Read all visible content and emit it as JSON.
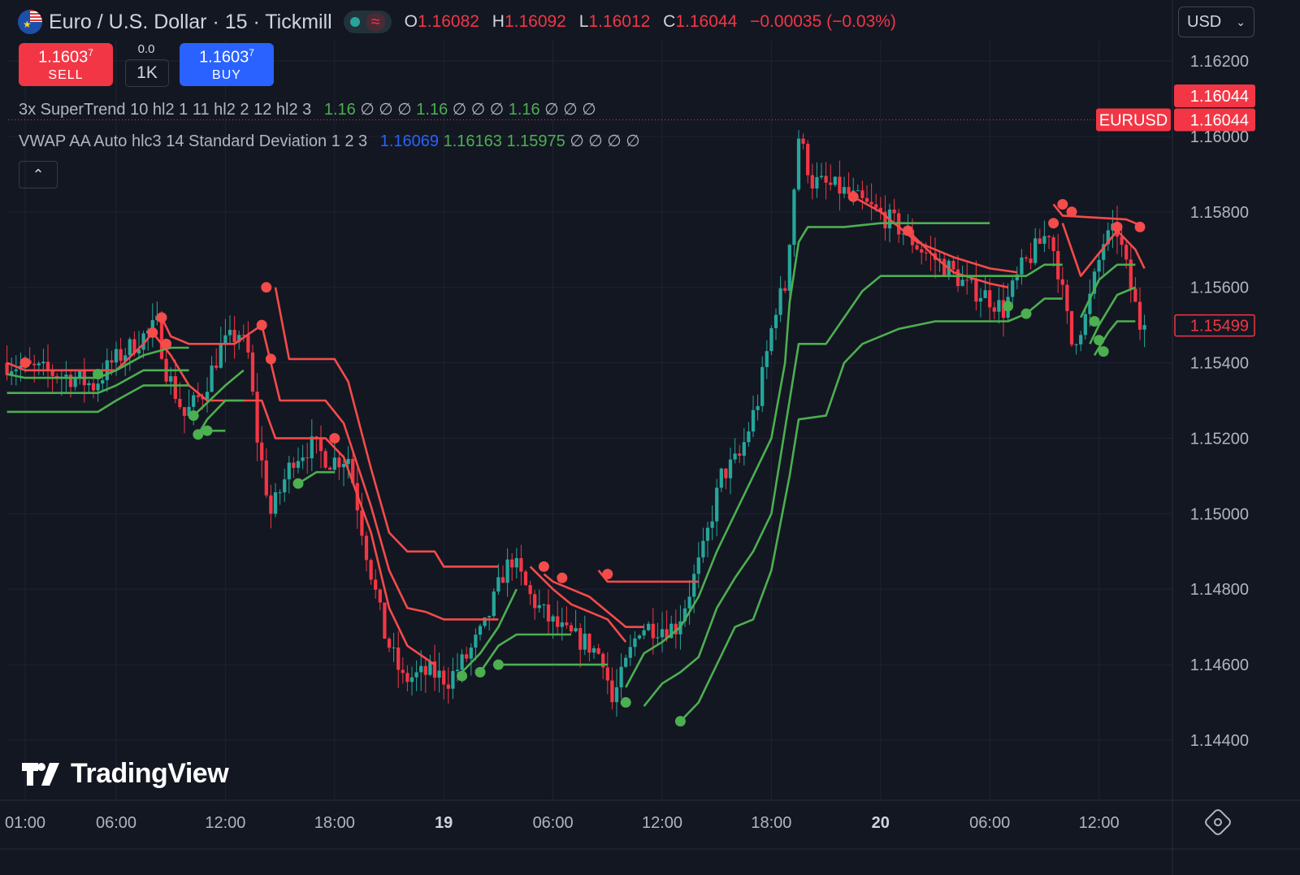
{
  "header": {
    "symbol_title": "Euro / U.S. Dollar · 15 · Tickmill",
    "o_label": "O",
    "o_value": "1.16082",
    "h_label": "H",
    "h_value": "1.16092",
    "l_label": "L",
    "l_value": "1.16012",
    "c_label": "C",
    "c_value": "1.16044",
    "change": "−0.00035 (−0.03%)",
    "currency": "USD"
  },
  "trade": {
    "sell_price": "1.1603",
    "sell_sup": "7",
    "sell_label": "SELL",
    "spread": "0.0",
    "quantity": "1K",
    "buy_price": "1.1603",
    "buy_sup": "7",
    "buy_label": "BUY"
  },
  "indicators": {
    "supertrend": {
      "name": "3x SuperTrend 10 hl2 1 11 hl2 2 12 hl2 3",
      "v1": "1.16",
      "v2": "1.16",
      "v3": "1.16",
      "na": "∅ ∅ ∅"
    },
    "vwap": {
      "name": "VWAP AA Auto hlc3 14 Standard Deviation 1 2 3",
      "v1": "1.16069",
      "v2": "1.16163",
      "v3": "1.15975",
      "na": "∅ ∅ ∅ ∅"
    }
  },
  "branding": "TradingView",
  "colors": {
    "up": "#26a69a",
    "down": "#f23645",
    "bg": "#131722",
    "st_red": "#f44b4b",
    "st_green": "#4caf50",
    "blue": "#2962ff"
  },
  "chart_data": {
    "type": "candlestick",
    "symbol_label": "EURUSD",
    "last_price": 1.16044,
    "marked_price": 1.15499,
    "y_ticks": [
      1.162,
      1.16,
      1.158,
      1.156,
      1.154,
      1.152,
      1.15,
      1.148,
      1.146,
      1.144
    ],
    "y_tick_labels": [
      "1.16200",
      "1.16000",
      "1.15800",
      "1.15600",
      "1.15400",
      "1.15200",
      "1.15000",
      "1.14800",
      "1.14600",
      "1.14400"
    ],
    "ylim": [
      1.1432,
      1.1633
    ],
    "x_ticks": [
      "01:00",
      "06:00",
      "12:00",
      "18:00",
      "19",
      "06:00",
      "12:00",
      "18:00",
      "20",
      "06:00",
      "12:00"
    ],
    "x_tick_bold": [
      false,
      false,
      false,
      false,
      true,
      false,
      false,
      false,
      true,
      false,
      false
    ],
    "x_tick_time": [
      "18 01:00",
      "18 06:00",
      "18 12:00",
      "18 18:00",
      "19 00:00",
      "19 06:00",
      "19 12:00",
      "19 18:00",
      "20 00:00",
      "20 06:00",
      "20 12:00"
    ],
    "close_path": [
      [
        "18 00:00",
        1.154
      ],
      [
        "18 01:00",
        1.1539
      ],
      [
        "18 04:00",
        1.1536
      ],
      [
        "18 05:00",
        1.1534
      ],
      [
        "18 06:00",
        1.154
      ],
      [
        "18 07:30",
        1.1546
      ],
      [
        "18 08:30",
        1.155
      ],
      [
        "18 09:00",
        1.1538
      ],
      [
        "18 10:00",
        1.1526
      ],
      [
        "18 11:00",
        1.1532
      ],
      [
        "18 12:00",
        1.1544
      ],
      [
        "18 13:00",
        1.1548
      ],
      [
        "18 13:30",
        1.1542
      ],
      [
        "18 14:00",
        1.152
      ],
      [
        "18 14:45",
        1.15
      ],
      [
        "18 16:00",
        1.1515
      ],
      [
        "18 17:00",
        1.1518
      ],
      [
        "18 18:00",
        1.1514
      ],
      [
        "18 19:00",
        1.1515
      ],
      [
        "18 20:00",
        1.149
      ],
      [
        "18 21:00",
        1.1468
      ],
      [
        "18 22:00",
        1.1456
      ],
      [
        "18 23:30",
        1.1458
      ],
      [
        "19 00:30",
        1.1456
      ],
      [
        "19 01:30",
        1.1462
      ],
      [
        "19 02:30",
        1.147
      ],
      [
        "19 03:30",
        1.1484
      ],
      [
        "19 04:00",
        1.1488
      ],
      [
        "19 05:00",
        1.1478
      ],
      [
        "19 06:00",
        1.1472
      ],
      [
        "19 07:00",
        1.1468
      ],
      [
        "19 08:00",
        1.1466
      ],
      [
        "19 09:00",
        1.1462
      ],
      [
        "19 09:30",
        1.145
      ],
      [
        "19 10:15",
        1.146
      ],
      [
        "19 11:00",
        1.147
      ],
      [
        "19 12:00",
        1.147
      ],
      [
        "19 13:00",
        1.147
      ],
      [
        "19 13:30",
        1.1476
      ],
      [
        "19 14:30",
        1.149
      ],
      [
        "19 15:30",
        1.151
      ],
      [
        "19 16:30",
        1.1515
      ],
      [
        "19 17:30",
        1.153
      ],
      [
        "19 18:30",
        1.1555
      ],
      [
        "19 19:00",
        1.156
      ],
      [
        "19 19:45",
        1.16
      ],
      [
        "19 20:30",
        1.1588
      ],
      [
        "19 22:00",
        1.1586
      ],
      [
        "20 00:00",
        1.158
      ],
      [
        "20 01:00",
        1.1577
      ],
      [
        "20 02:30",
        1.157
      ],
      [
        "20 04:00",
        1.1565
      ],
      [
        "20 05:00",
        1.156
      ],
      [
        "20 06:00",
        1.1558
      ],
      [
        "20 07:00",
        1.1554
      ],
      [
        "20 08:00",
        1.1565
      ],
      [
        "20 09:30",
        1.1575
      ],
      [
        "20 10:00",
        1.1565
      ],
      [
        "20 10:45",
        1.1545
      ],
      [
        "20 11:30",
        1.1552
      ],
      [
        "20 12:30",
        1.1572
      ],
      [
        "20 13:15",
        1.1575
      ],
      [
        "20 14:00",
        1.156
      ],
      [
        "20 14:30",
        1.155
      ]
    ],
    "supertrend": {
      "red_1": [
        [
          "18 00:00",
          1.154
        ],
        [
          "18 01:00",
          1.1538
        ],
        [
          "18 06:00",
          1.1538
        ],
        [
          "18 07:30",
          1.1545
        ],
        [
          "18 08:00",
          1.1548
        ],
        [
          "18 09:00",
          1.1542
        ],
        [
          "18 10:00",
          1.1534
        ],
        [
          "18 11:00",
          1.153
        ],
        [
          "18 14:00",
          1.153
        ],
        [
          "18 14:45",
          1.152
        ],
        [
          "18 17:30",
          1.152
        ],
        [
          "18 18:30",
          1.1515
        ],
        [
          "18 20:00",
          1.1495
        ],
        [
          "18 21:00",
          1.1475
        ],
        [
          "18 22:00",
          1.1465
        ],
        [
          "18 23:30",
          1.146
        ]
      ],
      "red_2": [
        [
          "18 08:30",
          1.1552
        ],
        [
          "18 09:00",
          1.1547
        ],
        [
          "18 10:00",
          1.1545
        ],
        [
          "18 12:30",
          1.1545
        ],
        [
          "18 14:00",
          1.155
        ],
        [
          "18 14:30",
          1.154
        ],
        [
          "18 15:00",
          1.153
        ],
        [
          "18 17:30",
          1.153
        ],
        [
          "18 18:30",
          1.1524
        ],
        [
          "18 20:00",
          1.1502
        ],
        [
          "18 21:00",
          1.1485
        ],
        [
          "18 22:00",
          1.1475
        ],
        [
          "18 23:00",
          1.1474
        ],
        [
          "19 00:00",
          1.1472
        ],
        [
          "19 03:00",
          1.1472
        ]
      ],
      "red_3": [
        [
          "18 14:45",
          1.156
        ],
        [
          "18 15:30",
          1.1541
        ],
        [
          "18 18:00",
          1.1541
        ],
        [
          "18 18:45",
          1.1535
        ],
        [
          "18 20:00",
          1.1512
        ],
        [
          "18 21:00",
          1.1495
        ],
        [
          "18 22:00",
          1.149
        ],
        [
          "18 23:30",
          1.149
        ],
        [
          "19 00:00",
          1.1486
        ],
        [
          "19 03:00",
          1.1486
        ]
      ],
      "red_4": [
        [
          "19 04:45",
          1.1486
        ],
        [
          "19 06:00",
          1.148
        ],
        [
          "19 07:00",
          1.1476
        ],
        [
          "19 08:00",
          1.1474
        ],
        [
          "19 09:00",
          1.1472
        ],
        [
          "19 10:00",
          1.1466
        ]
      ],
      "red_5": [
        [
          "19 05:30",
          1.1484
        ],
        [
          "19 06:00",
          1.1482
        ],
        [
          "19 07:00",
          1.148
        ],
        [
          "19 08:00",
          1.1478
        ],
        [
          "19 09:00",
          1.1474
        ],
        [
          "19 10:00",
          1.147
        ],
        [
          "19 11:00",
          1.147
        ]
      ],
      "red_6": [
        [
          "19 08:30",
          1.1485
        ],
        [
          "19 09:00",
          1.1482
        ],
        [
          "19 14:00",
          1.1482
        ]
      ],
      "red_7": [
        [
          "19 22:30",
          1.1584
        ],
        [
          "20 00:00",
          1.158
        ],
        [
          "20 02:00",
          1.1572
        ],
        [
          "20 04:00",
          1.1568
        ],
        [
          "20 06:00",
          1.1565
        ],
        [
          "20 07:30",
          1.1564
        ]
      ],
      "red_8": [
        [
          "20 01:30",
          1.1575
        ],
        [
          "20 03:00",
          1.1568
        ],
        [
          "20 04:00",
          1.1564
        ],
        [
          "20 06:00",
          1.1561
        ],
        [
          "20 07:00",
          1.156
        ]
      ],
      "red_9": [
        [
          "20 09:30",
          1.1582
        ],
        [
          "20 10:00",
          1.1579
        ],
        [
          "20 13:30",
          1.1578
        ],
        [
          "20 14:30",
          1.1576
        ]
      ],
      "red_10": [
        [
          "20 10:00",
          1.1577
        ],
        [
          "20 11:00",
          1.1563
        ],
        [
          "20 13:00",
          1.1575
        ],
        [
          "20 14:00",
          1.157
        ],
        [
          "20 14:30",
          1.1565
        ]
      ],
      "green_1": [
        [
          "18 00:00",
          1.1537
        ],
        [
          "18 01:00",
          1.1536
        ],
        [
          "18 05:00",
          1.1536
        ],
        [
          "18 06:00",
          1.1538
        ],
        [
          "18 07:30",
          1.1542
        ],
        [
          "18 09:00",
          1.1544
        ],
        [
          "18 10:00",
          1.1544
        ]
      ],
      "green_2": [
        [
          "18 00:00",
          1.1532
        ],
        [
          "18 02:00",
          1.1532
        ],
        [
          "18 05:00",
          1.1532
        ],
        [
          "18 06:00",
          1.1534
        ],
        [
          "18 07:30",
          1.1538
        ],
        [
          "18 09:00",
          1.1538
        ],
        [
          "18 10:00",
          1.1538
        ]
      ],
      "green_3": [
        [
          "18 00:00",
          1.1527
        ],
        [
          "18 05:00",
          1.1527
        ],
        [
          "18 06:00",
          1.153
        ],
        [
          "18 07:30",
          1.1534
        ],
        [
          "18 09:00",
          1.1534
        ],
        [
          "18 10:00",
          1.1534
        ]
      ],
      "green_4": [
        [
          "18 10:15",
          1.1526
        ],
        [
          "18 12:00",
          1.1534
        ],
        [
          "18 13:00",
          1.1538
        ]
      ],
      "green_5": [
        [
          "18 10:30",
          1.1521
        ],
        [
          "18 11:00",
          1.1525
        ],
        [
          "18 12:00",
          1.153
        ],
        [
          "18 13:00",
          1.153
        ]
      ],
      "green_6": [
        [
          "18 11:15",
          1.1522
        ],
        [
          "18 12:00",
          1.1522
        ]
      ],
      "green_7": [
        [
          "18 16:00",
          1.1508
        ],
        [
          "18 17:00",
          1.1511
        ],
        [
          "18 18:00",
          1.1511
        ]
      ],
      "green_8": [
        [
          "19 01:00",
          1.1458
        ],
        [
          "19 02:00",
          1.1463
        ],
        [
          "19 03:00",
          1.147
        ],
        [
          "19 04:00",
          1.148
        ]
      ],
      "green_9": [
        [
          "19 02:00",
          1.1458
        ],
        [
          "19 03:00",
          1.1465
        ],
        [
          "19 04:00",
          1.1468
        ],
        [
          "19 05:00",
          1.1468
        ],
        [
          "19 06:00",
          1.1468
        ],
        [
          "19 07:00",
          1.1468
        ]
      ],
      "green_10": [
        [
          "19 03:00",
          1.146
        ],
        [
          "19 04:00",
          1.146
        ],
        [
          "19 06:00",
          1.146
        ],
        [
          "19 07:00",
          1.146
        ],
        [
          "19 08:00",
          1.146
        ],
        [
          "19 09:00",
          1.146
        ]
      ],
      "green_11": [
        [
          "19 10:00",
          1.1454
        ],
        [
          "19 11:00",
          1.1463
        ],
        [
          "19 12:00",
          1.1466
        ],
        [
          "19 13:00",
          1.147
        ],
        [
          "19 14:00",
          1.1478
        ],
        [
          "19 15:00",
          1.149
        ],
        [
          "19 16:00",
          1.15
        ],
        [
          "19 17:00",
          1.151
        ],
        [
          "19 18:00",
          1.152
        ],
        [
          "19 18:45",
          1.154
        ],
        [
          "19 19:00",
          1.1556
        ],
        [
          "19 19:30",
          1.1572
        ],
        [
          "19 20:00",
          1.1576
        ],
        [
          "19 22:00",
          1.1576
        ],
        [
          "20 00:00",
          1.1577
        ],
        [
          "20 06:00",
          1.1577
        ]
      ],
      "green_12": [
        [
          "19 11:00",
          1.1449
        ],
        [
          "19 12:00",
          1.1455
        ],
        [
          "19 13:00",
          1.1458
        ],
        [
          "19 14:00",
          1.1462
        ],
        [
          "19 15:00",
          1.1475
        ],
        [
          "19 16:00",
          1.1483
        ],
        [
          "19 17:00",
          1.149
        ],
        [
          "19 18:00",
          1.15
        ],
        [
          "19 19:00",
          1.153
        ],
        [
          "19 19:30",
          1.1545
        ],
        [
          "19 21:00",
          1.1545
        ],
        [
          "19 22:00",
          1.1552
        ],
        [
          "19 23:00",
          1.1559
        ],
        [
          "20 00:00",
          1.1563
        ],
        [
          "20 07:00",
          1.1563
        ],
        [
          "20 08:00",
          1.1563
        ],
        [
          "20 09:00",
          1.1566
        ],
        [
          "20 10:00",
          1.1566
        ]
      ],
      "green_13": [
        [
          "19 13:00",
          1.1445
        ],
        [
          "19 14:00",
          1.145
        ],
        [
          "19 15:00",
          1.146
        ],
        [
          "19 16:00",
          1.147
        ],
        [
          "19 17:00",
          1.1472
        ],
        [
          "19 18:00",
          1.1485
        ],
        [
          "19 19:00",
          1.151
        ],
        [
          "19 19:30",
          1.1525
        ],
        [
          "19 21:00",
          1.1526
        ],
        [
          "19 22:00",
          1.154
        ],
        [
          "19 23:00",
          1.1545
        ],
        [
          "20 01:00",
          1.1549
        ],
        [
          "20 03:00",
          1.1551
        ],
        [
          "20 07:00",
          1.1551
        ],
        [
          "20 08:00",
          1.1553
        ],
        [
          "20 09:00",
          1.1557
        ],
        [
          "20 10:00",
          1.1557
        ]
      ],
      "green_14": [
        [
          "20 11:00",
          1.1552
        ],
        [
          "20 12:00",
          1.1562
        ],
        [
          "20 13:00",
          1.1566
        ],
        [
          "20 14:00",
          1.1566
        ]
      ],
      "green_15": [
        [
          "20 11:30",
          1.1545
        ],
        [
          "20 12:00",
          1.155
        ],
        [
          "20 13:00",
          1.1558
        ],
        [
          "20 14:00",
          1.156
        ]
      ],
      "green_16": [
        [
          "20 11:45",
          1.1542
        ],
        [
          "20 12:30",
          1.1548
        ],
        [
          "20 13:00",
          1.1551
        ],
        [
          "20 14:00",
          1.1551
        ]
      ]
    },
    "red_markers": [
      [
        "18 01:00",
        1.154
      ],
      [
        "18 08:00",
        1.1548
      ],
      [
        "18 08:30",
        1.1552
      ],
      [
        "18 08:45",
        1.1545
      ],
      [
        "18 14:00",
        1.155
      ],
      [
        "18 14:15",
        1.156
      ],
      [
        "18 14:30",
        1.1541
      ],
      [
        "18 18:00",
        1.152
      ],
      [
        "19 05:30",
        1.1486
      ],
      [
        "19 06:30",
        1.1483
      ],
      [
        "19 09:00",
        1.1484
      ],
      [
        "19 22:30",
        1.1584
      ],
      [
        "20 01:30",
        1.1575
      ],
      [
        "20 10:00",
        1.1582
      ],
      [
        "20 10:30",
        1.158
      ],
      [
        "20 09:30",
        1.1577
      ],
      [
        "20 13:00",
        1.1576
      ],
      [
        "20 14:15",
        1.1576
      ]
    ],
    "green_markers": [
      [
        "18 05:00",
        1.1537
      ],
      [
        "18 10:15",
        1.1526
      ],
      [
        "18 10:30",
        1.1521
      ],
      [
        "18 11:00",
        1.1522
      ],
      [
        "18 16:00",
        1.1508
      ],
      [
        "19 01:00",
        1.1457
      ],
      [
        "19 02:00",
        1.1458
      ],
      [
        "19 03:00",
        1.146
      ],
      [
        "19 10:00",
        1.145
      ],
      [
        "19 13:00",
        1.1445
      ],
      [
        "20 07:00",
        1.1555
      ],
      [
        "20 08:00",
        1.1553
      ],
      [
        "20 11:45",
        1.1551
      ],
      [
        "20 12:00",
        1.1546
      ],
      [
        "20 12:15",
        1.1543
      ]
    ]
  }
}
